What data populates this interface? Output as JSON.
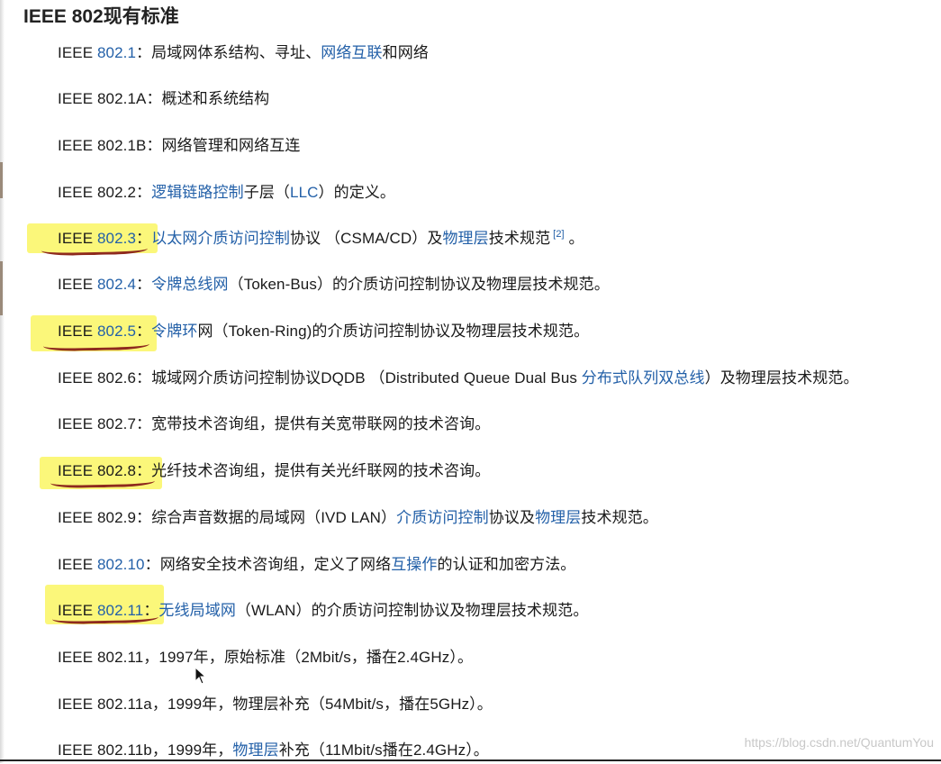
{
  "title": "IEEE 802现有标准",
  "watermark": "https://blog.csdn.net/QuantumYou",
  "entries": [
    {
      "prefix": "IEEE ",
      "num": "802.1",
      "sep": "：",
      "desc": [
        {
          "text": "局域网体系结构、寻址、",
          "link": false
        },
        {
          "text": "网络互联",
          "link": true
        },
        {
          "text": "和网络",
          "link": false
        }
      ]
    },
    {
      "prefix": "IEEE 802.1A：",
      "desc": [
        {
          "text": "概述和系统结构",
          "link": false
        }
      ]
    },
    {
      "prefix": "IEEE 802.1B：",
      "desc": [
        {
          "text": "网络管理和网络互连",
          "link": false
        }
      ]
    },
    {
      "prefix": "IEEE 802.2：",
      "desc": [
        {
          "text": "逻辑链路控制",
          "link": true
        },
        {
          "text": "子层（",
          "link": false
        },
        {
          "text": "LLC",
          "link": true
        },
        {
          "text": "）的定义。",
          "link": false
        }
      ]
    },
    {
      "prefix": "IEEE ",
      "num": "802.3",
      "sep": "：",
      "sup": "[2]",
      "desc": [
        {
          "text": "以太网介质访问控制",
          "link": true
        },
        {
          "text": "协议 （CSMA/CD）及",
          "link": false
        },
        {
          "text": "物理层",
          "link": true
        },
        {
          "text": "技术规范",
          "link": false
        }
      ],
      "tail": " 。"
    },
    {
      "prefix": "IEEE ",
      "num": "802.4",
      "sep": "：",
      "desc": [
        {
          "text": "令牌总线网",
          "link": true
        },
        {
          "text": "（Token-Bus）的介质访问控制协议及物理层技术规范。",
          "link": false
        }
      ]
    },
    {
      "prefix": "IEEE ",
      "num": "802.5",
      "sep": "：",
      "desc": [
        {
          "text": "令牌环",
          "link": true
        },
        {
          "text": "网（Token-Ring)的介质访问控制协议及物理层技术规范。",
          "link": false
        }
      ]
    },
    {
      "prefix": "IEEE 802.6：",
      "desc": [
        {
          "text": "城域网介质访问控制协议DQDB （Distributed Queue Dual Bus ",
          "link": false
        },
        {
          "text": "分布式队列双总线",
          "link": true
        },
        {
          "text": "）及物理层技术规范。",
          "link": false
        }
      ]
    },
    {
      "prefix": "IEEE 802.7：",
      "desc": [
        {
          "text": "宽带技术咨询组，提供有关宽带联网的技术咨询。",
          "link": false
        }
      ]
    },
    {
      "prefix": "IEEE 802.8：",
      "desc": [
        {
          "text": "光纤技术咨询组，提供有关光纤联网的技术咨询。",
          "link": false
        }
      ]
    },
    {
      "prefix": "IEEE 802.9：",
      "desc": [
        {
          "text": "综合声音数据的局域网（IVD LAN）",
          "link": false
        },
        {
          "text": "介质访问控制",
          "link": true
        },
        {
          "text": "协议及",
          "link": false
        },
        {
          "text": "物理层",
          "link": true
        },
        {
          "text": "技术规范。",
          "link": false
        }
      ]
    },
    {
      "prefix": "IEEE ",
      "num": "802.10",
      "sep": "：",
      "desc": [
        {
          "text": "网络安全技术咨询组，定义了网络",
          "link": false
        },
        {
          "text": "互操作",
          "link": true
        },
        {
          "text": "的认证和加密方法。",
          "link": false
        }
      ]
    },
    {
      "prefix": "IEEE ",
      "num": "802.11",
      "sep": "：",
      "desc": [
        {
          "text": "无线局域网",
          "link": true
        },
        {
          "text": "（WLAN）的介质访问控制协议及物理层技术规范。",
          "link": false
        }
      ]
    },
    {
      "prefix": "IEEE 802.11，",
      "desc": [
        {
          "text": "1997年，原始标准（2Mbit/s，播在2.4GHz）。",
          "link": false
        }
      ]
    },
    {
      "prefix": "IEEE 802.11a，",
      "desc": [
        {
          "text": "1999年，物理层补充（54Mbit/s，播在5GHz）。",
          "link": false
        }
      ]
    },
    {
      "prefix": "IEEE 802.11b，",
      "desc": [
        {
          "text": "1999年，",
          "link": false
        },
        {
          "text": "物理层",
          "link": true
        },
        {
          "text": "补充（11Mbit/s播在2.4GHz）。",
          "link": false
        }
      ]
    }
  ]
}
